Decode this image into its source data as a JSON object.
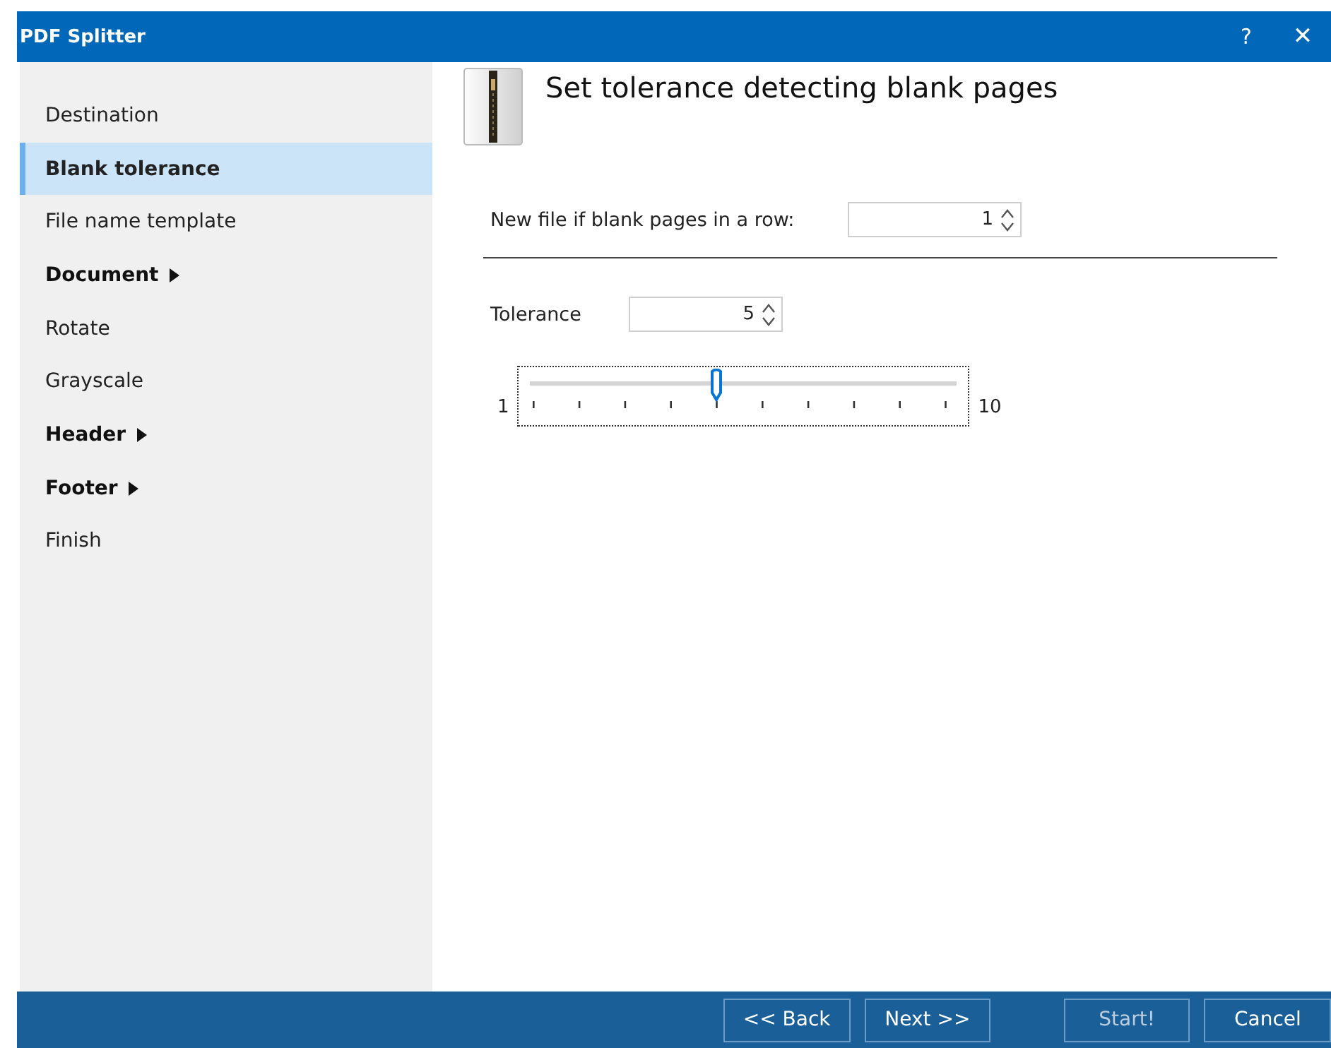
{
  "window": {
    "title": "PDF Splitter",
    "help": "?",
    "close": "✕"
  },
  "sidebar": {
    "items": [
      {
        "label": "Destination",
        "selected": false,
        "expandable": false
      },
      {
        "label": "Blank tolerance",
        "selected": true,
        "expandable": false
      },
      {
        "label": "File name template",
        "selected": false,
        "expandable": false
      },
      {
        "label": "Document",
        "selected": false,
        "expandable": true
      },
      {
        "label": "Rotate",
        "selected": false,
        "expandable": false
      },
      {
        "label": "Grayscale",
        "selected": false,
        "expandable": false
      },
      {
        "label": "Header",
        "selected": false,
        "expandable": true
      },
      {
        "label": "Footer",
        "selected": false,
        "expandable": true
      },
      {
        "label": "Finish",
        "selected": false,
        "expandable": false
      }
    ]
  },
  "page": {
    "heading": "Set tolerance detecting blank pages",
    "blank_pages": {
      "label": "New file if blank pages in a row:",
      "value": "1"
    },
    "tolerance": {
      "label": "Tolerance",
      "value": "5"
    },
    "slider": {
      "min_label": "1",
      "max_label": "10",
      "level": 0.444
    }
  },
  "buttons": {
    "navigation": [
      {
        "label": "<< Back",
        "disabled": false
      },
      {
        "label": "Next >>",
        "disabled": false
      }
    ],
    "actions": [
      {
        "label": "Start!",
        "disabled": true
      },
      {
        "label": "Cancel",
        "disabled": false
      }
    ]
  }
}
